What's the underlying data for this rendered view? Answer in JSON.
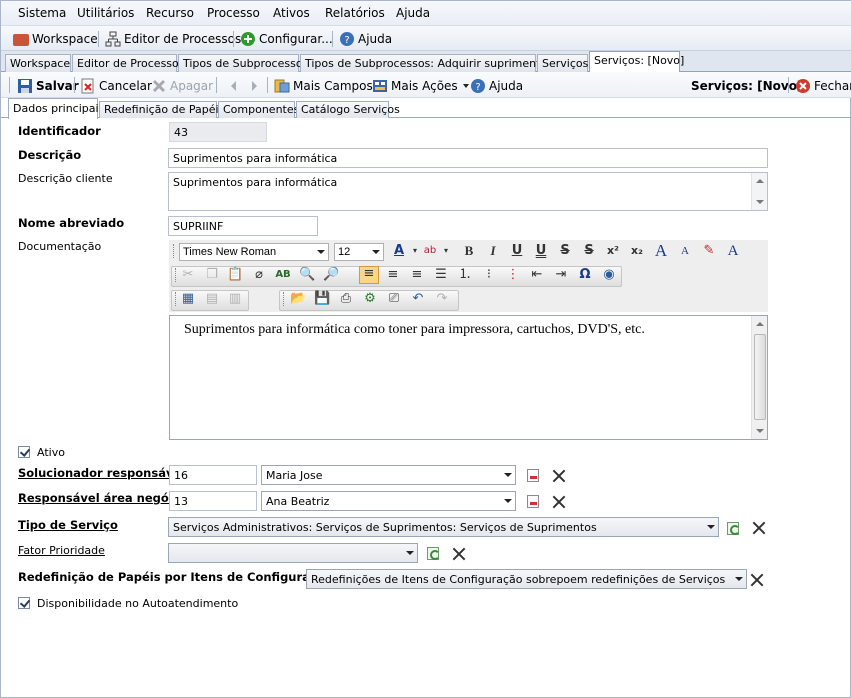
{
  "menu": [
    "Sistema",
    "Utilitários",
    "Recurso",
    "Processo",
    "Ativos",
    "Relatórios",
    "Ajuda"
  ],
  "toolbar1": {
    "workspace": "Workspace",
    "editor_processos": "Editor de Processos",
    "configurar": "Configurar...",
    "ajuda": "Ajuda"
  },
  "doc_tabs": [
    "Workspace",
    "Editor de Processos",
    "Tipos de Subprocessos",
    "Tipos de Subprocessos: Adquirir suprimentos [*]",
    "Serviços",
    "Serviços: [Novo]"
  ],
  "toolbar2": {
    "salvar": "Salvar",
    "cancelar": "Cancelar",
    "apagar": "Apagar",
    "mais_campos": "Mais Campos",
    "mais_acoes": "Mais Ações",
    "ajuda": "Ajuda",
    "title": "Serviços: [Novo]",
    "fechar": "Fechar"
  },
  "sub_tabs": [
    "Dados principais",
    "Redefinição de Papéis",
    "Componentes",
    "Catálogo Serviços"
  ],
  "form": {
    "identificador_label": "Identificador",
    "identificador_value": "43",
    "descricao_label": "Descrição",
    "descricao_value": "Suprimentos para informática",
    "descricao_cliente_label": "Descrição cliente",
    "descricao_cliente_value": "Suprimentos para informática",
    "nome_abreviado_label": "Nome abreviado",
    "nome_abreviado_value": "SUPRIINF",
    "documentacao_label": "Documentação",
    "editor": {
      "font_name": "Times New Roman",
      "font_size": "12",
      "content": "Suprimentos para informática como toner para impressora, cartuchos, DVD'S, etc."
    },
    "ativo_label": "Ativo",
    "ativo_checked": true,
    "solucionador_label": "Solucionador responsável",
    "solucionador_id": "16",
    "solucionador_name": "Maria Jose",
    "responsavel_label": "Responsável área negócio",
    "responsavel_id": "13",
    "responsavel_name": "Ana Beatriz",
    "tipo_servico_label": "Tipo de Serviço",
    "tipo_servico_value": "Serviços Administrativos: Serviços de Suprimentos: Serviços de Suprimentos",
    "fator_prioridade_label": "Fator Prioridade",
    "fator_prioridade_value": "",
    "redefinicao_label": "Redefinição de Papéis por Itens de Configuração",
    "redefinicao_value": "Redefinições de Itens de Configuração sobrepoem redefinições de Serviços",
    "disponibilidade_label": "Disponibilidade no Autoatendimento",
    "disponibilidade_checked": true
  }
}
